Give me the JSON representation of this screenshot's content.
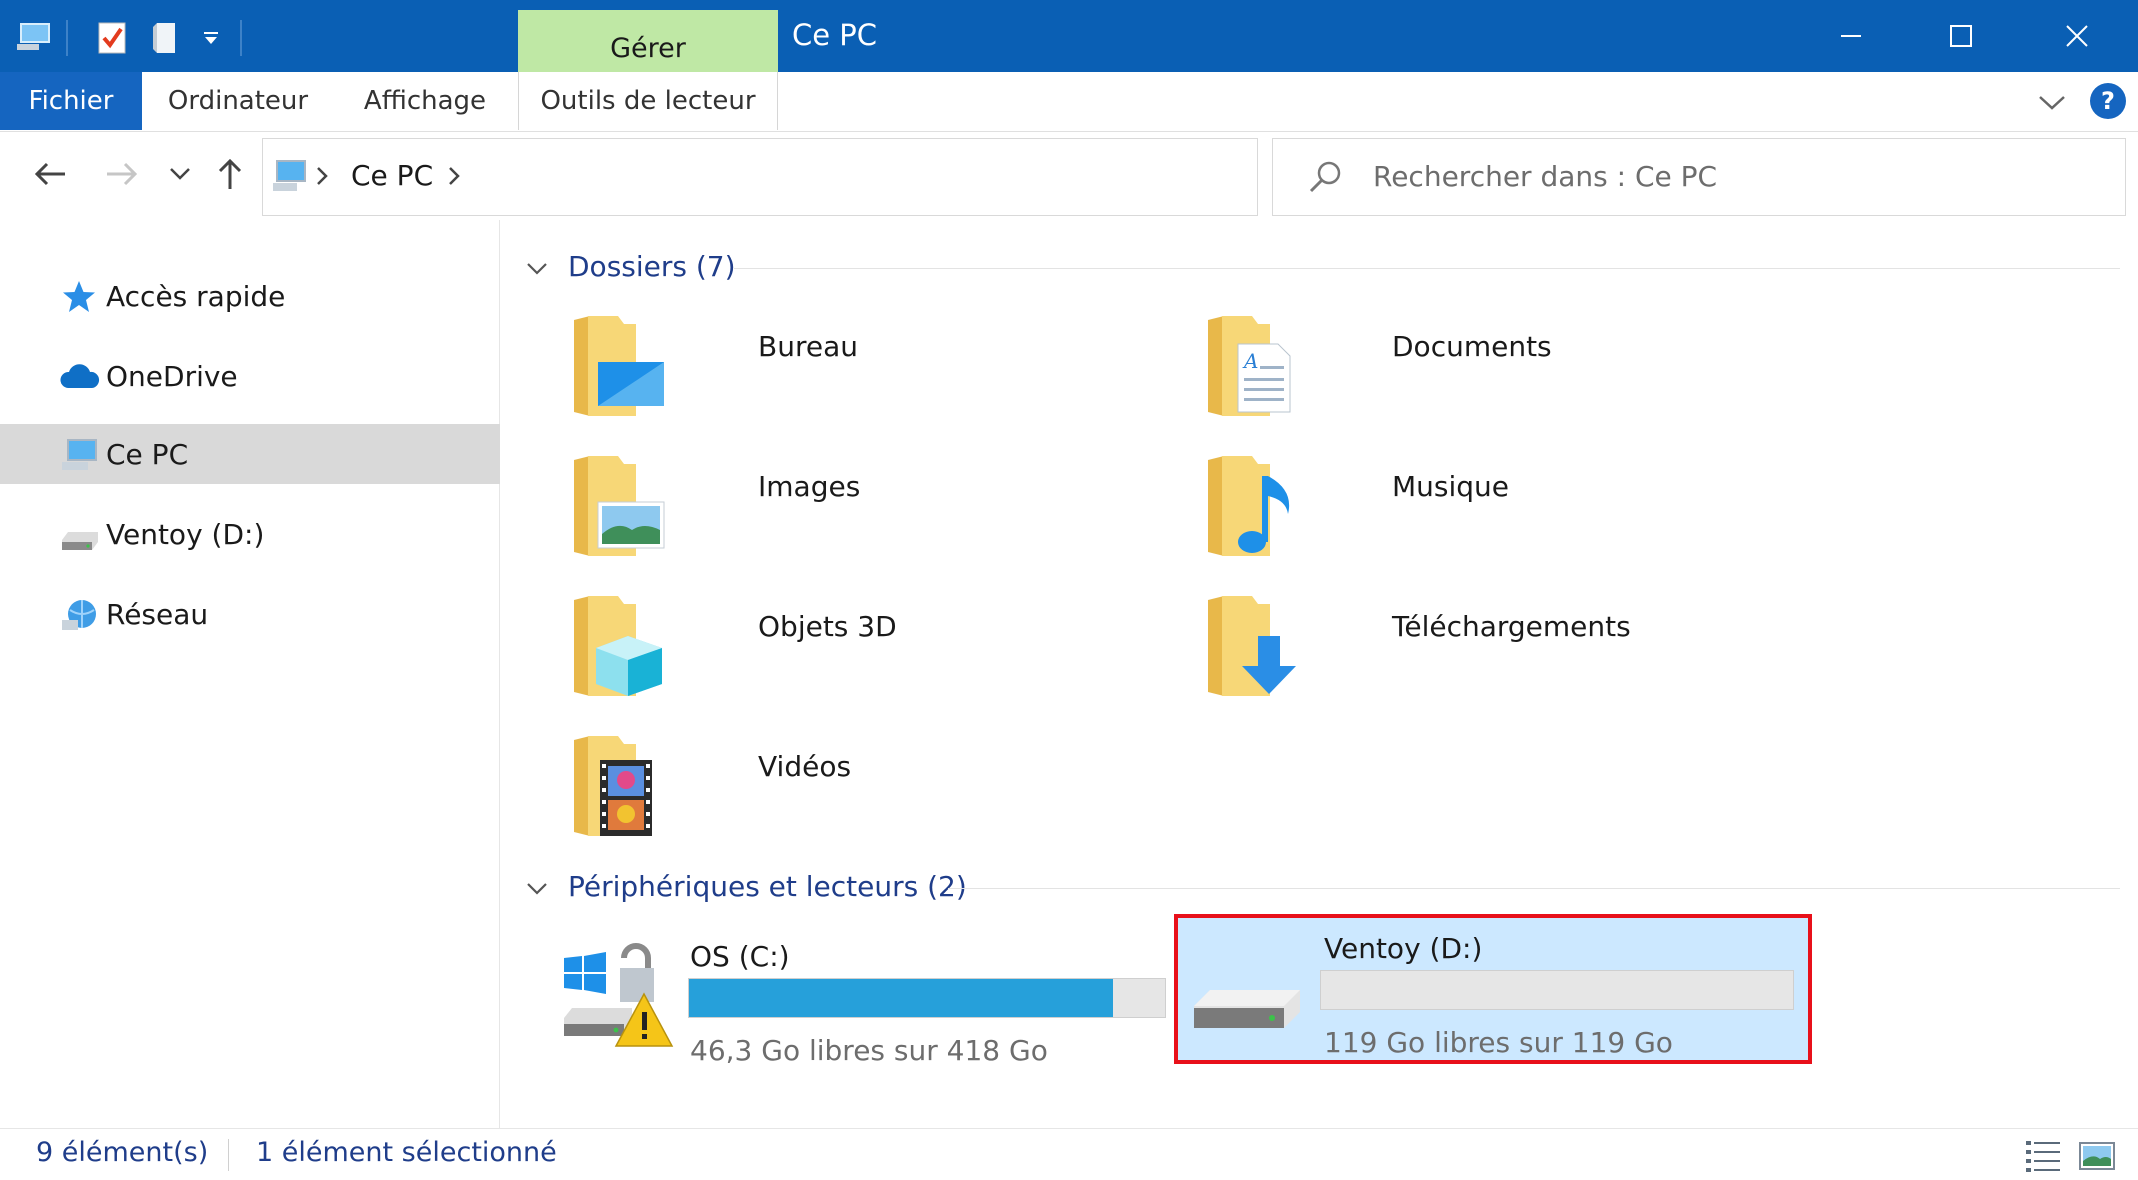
{
  "window": {
    "title": "Ce PC",
    "context_tab": "Gérer",
    "context_tab_color": "#bfe8a5",
    "titlebar_color": "#0a5fb4"
  },
  "ribbon": {
    "tabs": [
      "Fichier",
      "Ordinateur",
      "Affichage",
      "Outils de lecteur"
    ],
    "help_label": "?"
  },
  "address": {
    "path": "Ce PC",
    "search_placeholder": "Rechercher dans : Ce PC"
  },
  "sidebar": {
    "items": [
      {
        "label": "Accès rapide",
        "icon": "star-icon"
      },
      {
        "label": "OneDrive",
        "icon": "cloud-icon"
      },
      {
        "label": "Ce PC",
        "icon": "computer-icon",
        "selected": true
      },
      {
        "label": "Ventoy (D:)",
        "icon": "drive-icon"
      },
      {
        "label": "Réseau",
        "icon": "network-icon"
      }
    ]
  },
  "groups": {
    "folders": {
      "title": "Dossiers (7)",
      "items": [
        {
          "label": "Bureau",
          "icon": "desktop-folder-icon"
        },
        {
          "label": "Documents",
          "icon": "documents-folder-icon"
        },
        {
          "label": "Images",
          "icon": "pictures-folder-icon"
        },
        {
          "label": "Musique",
          "icon": "music-folder-icon"
        },
        {
          "label": "Objets 3D",
          "icon": "3d-objects-folder-icon"
        },
        {
          "label": "Téléchargements",
          "icon": "downloads-folder-icon"
        },
        {
          "label": "Vidéos",
          "icon": "videos-folder-icon"
        }
      ]
    },
    "drives": {
      "title": "Périphériques et lecteurs (2)",
      "items": [
        {
          "label": "OS (C:)",
          "free": "46,3 Go libres sur 418 Go",
          "used_fraction": 0.89,
          "icon": "windows-drive-icon"
        },
        {
          "label": "Ventoy (D:)",
          "free": "119 Go libres sur 119 Go",
          "used_fraction": 0.0,
          "icon": "drive-icon",
          "selected": true
        }
      ]
    }
  },
  "status": {
    "count": "9 élément(s)",
    "selection": "1 élément sélectionné"
  },
  "colors": {
    "accent": "#1565c0",
    "selection": "#cce8ff",
    "highlight_border": "#e8101a",
    "progress": "#26a0da"
  }
}
